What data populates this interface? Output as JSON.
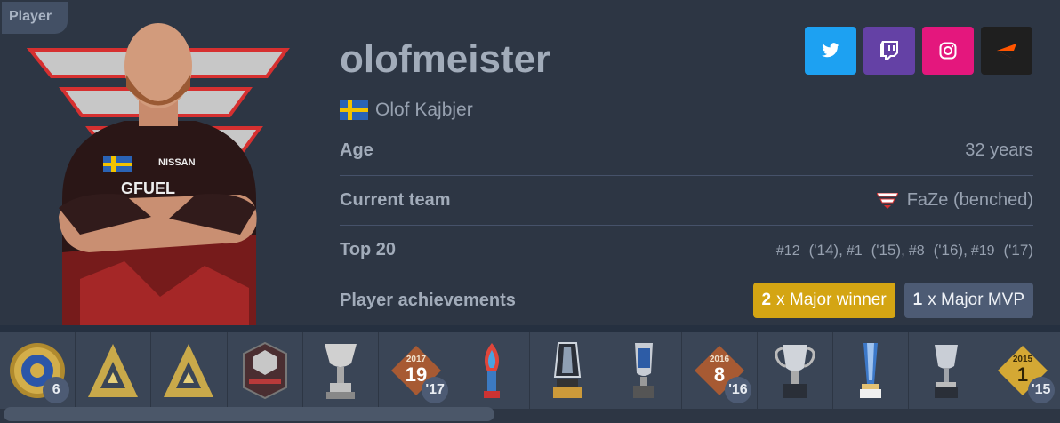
{
  "header": {
    "tag": "Player"
  },
  "player": {
    "nickname": "olofmeister",
    "real_name": "Olof Kajbjer",
    "country_flag": "sweden-flag"
  },
  "socials": [
    {
      "name": "twitter",
      "color": "#1da1f2"
    },
    {
      "name": "twitch",
      "color": "#6441a5"
    },
    {
      "name": "instagram",
      "color": "#e4177d"
    },
    {
      "name": "faceit",
      "color": "#1f1f1f"
    }
  ],
  "stats": {
    "age_label": "Age",
    "age_value": "32 years",
    "team_label": "Current team",
    "team_value": "FaZe (benched)",
    "top20_label": "Top 20",
    "top20": [
      {
        "rank": "#12",
        "year": "('14),"
      },
      {
        "rank": "#1",
        "year": "('15),"
      },
      {
        "rank": "#8",
        "year": "('16),"
      },
      {
        "rank": "#19",
        "year": "('17)"
      }
    ],
    "achievements_label": "Player achievements",
    "major_winner_count": "2",
    "major_winner_text": "x Major winner",
    "major_mvp_count": "1",
    "major_mvp_text": "x Major MVP"
  },
  "trophies": [
    {
      "icon": "major-coin-icon",
      "badge": "6"
    },
    {
      "icon": "blast-trophy-icon",
      "badge": ""
    },
    {
      "icon": "blast-trophy-icon",
      "badge": ""
    },
    {
      "icon": "eleague-invitational-icon",
      "badge": ""
    },
    {
      "icon": "silver-cup-icon",
      "badge": ""
    },
    {
      "icon": "top20-2017-icon",
      "badge": "'17",
      "year": "2017",
      "rank": "19"
    },
    {
      "icon": "red-flame-trophy-icon",
      "badge": ""
    },
    {
      "icon": "crystal-trophy-icon",
      "badge": ""
    },
    {
      "icon": "esl-trophy-icon",
      "badge": ""
    },
    {
      "icon": "top20-2016-icon",
      "badge": "'16",
      "year": "2016",
      "rank": "8"
    },
    {
      "icon": "silver-cup-handles-icon",
      "badge": ""
    },
    {
      "icon": "blue-pillar-trophy-icon",
      "badge": ""
    },
    {
      "icon": "silver-goblet-icon",
      "badge": ""
    },
    {
      "icon": "top20-2015-gold-icon",
      "badge": "'15",
      "year": "2015",
      "rank": "1"
    }
  ]
}
